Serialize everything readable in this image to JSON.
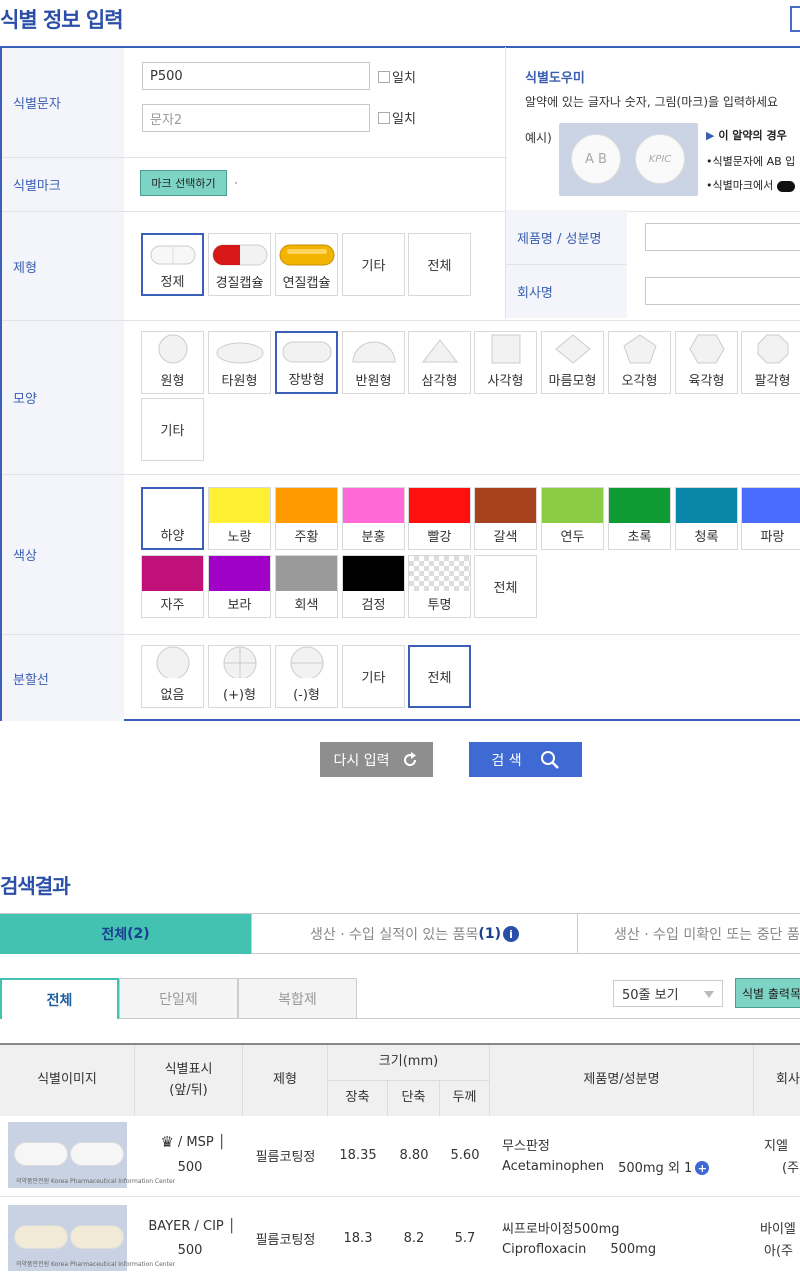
{
  "page_title": "식별 정보 입력",
  "form": {
    "id_text": {
      "label": "식별문자",
      "input1_value": "P500",
      "input2_placeholder": "문자2",
      "match_label": "일치"
    },
    "id_mark": {
      "label": "식별마크",
      "button": "마크 선택하기"
    },
    "helper": {
      "title": "식별도우미",
      "desc": "알약에 있는 글자나 숫자, 그림(마크)을 입력하세요",
      "example_label": "예시)",
      "pill_texts": [
        "A B",
        "KPIC"
      ],
      "note1": "이 알약의 경우",
      "note2": "•식별문자에 AB 입",
      "note3": "•식별마크에서"
    },
    "dosage": {
      "label": "제형",
      "options": [
        "정제",
        "경질캡슐",
        "연질캡슐",
        "기타",
        "전체"
      ],
      "selected": "정제"
    },
    "product_name_label": "제품명 / 성분명",
    "company_label": "회사명",
    "shape": {
      "label": "모양",
      "options": [
        "원형",
        "타원형",
        "장방형",
        "반원형",
        "삼각형",
        "사각형",
        "마름모형",
        "오각형",
        "육각형",
        "팔각형",
        "기타"
      ],
      "selected": "장방형"
    },
    "color": {
      "label": "색상",
      "options": [
        {
          "name": "하양",
          "hex": "#ffffff"
        },
        {
          "name": "노랑",
          "hex": "#fff033"
        },
        {
          "name": "주황",
          "hex": "#ff9a00"
        },
        {
          "name": "분홍",
          "hex": "#ff6ad8"
        },
        {
          "name": "빨강",
          "hex": "#ff1010"
        },
        {
          "name": "갈색",
          "hex": "#a8421e"
        },
        {
          "name": "연두",
          "hex": "#8ccc44"
        },
        {
          "name": "초록",
          "hex": "#0e9b34"
        },
        {
          "name": "청록",
          "hex": "#0a86a8"
        },
        {
          "name": "파랑",
          "hex": "#4a6cff"
        },
        {
          "name": "자주",
          "hex": "#c0107a"
        },
        {
          "name": "보라",
          "hex": "#a000c8"
        },
        {
          "name": "회색",
          "hex": "#9a9a9a"
        },
        {
          "name": "검정",
          "hex": "#000000"
        },
        {
          "name": "투명",
          "hex": "checker"
        },
        {
          "name": "전체",
          "hex": ""
        }
      ],
      "selected": "하양"
    },
    "split_line": {
      "label": "분할선",
      "options": [
        "없음",
        "(+)형",
        "(-)형",
        "기타",
        "전체"
      ],
      "selected": "전체"
    }
  },
  "buttons": {
    "reset": "다시 입력",
    "search": "검 색"
  },
  "results": {
    "title": "검색결과",
    "main_tabs": [
      {
        "label": "전체",
        "count": "2"
      },
      {
        "label": "생산 · 수입 실적이 있는 품목",
        "count": "1"
      },
      {
        "label": "생산 · 수입 미확인 또는 중단 품"
      }
    ],
    "sub_tabs": [
      "전체",
      "단일제",
      "복합제"
    ],
    "page_size": "50줄 보기",
    "print_button": "식별 출력목",
    "columns": {
      "image": "식별이미지",
      "marking": "식별표시",
      "marking_sub": "(앞/뒤)",
      "dosage": "제형",
      "size": "크기(mm)",
      "long": "장축",
      "short": "단축",
      "thick": "두께",
      "product": "제품명/성분명",
      "company": "회사"
    },
    "rows": [
      {
        "marking_line1": "/ MSP",
        "marking_line2": "500",
        "dosage": "필름코팅정",
        "long": "18.35",
        "short": "8.80",
        "thick": "5.60",
        "product": "무스판정",
        "ingredient": "Acetaminophen",
        "amount": "500mg 외 1",
        "company_line1": "지엘",
        "company_line2": "(주",
        "thumb_footer": "의약품안전원   Korea Pharmaceutical Information Center"
      },
      {
        "marking_line1": "BAYER / CIP",
        "marking_line2": "500",
        "dosage": "필름코팅정",
        "long": "18.3",
        "short": "8.2",
        "thick": "5.7",
        "product": "씨프로바이정500mg",
        "ingredient": "Ciprofloxacin",
        "amount": "500mg",
        "company_line1": "바이엘",
        "company_line2": "아(주",
        "thumb_footer": "의약품안전원   Korea Pharmaceutical Information Center"
      }
    ]
  }
}
